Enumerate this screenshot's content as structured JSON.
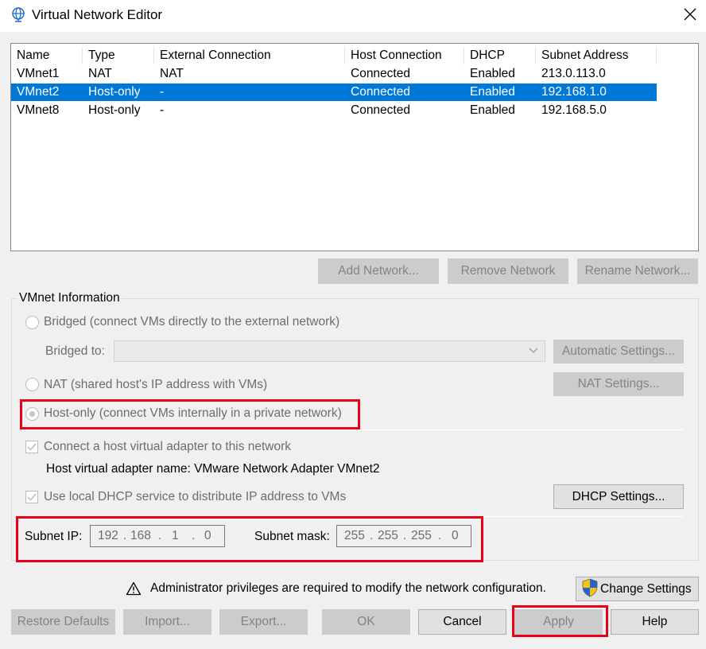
{
  "window": {
    "title": "Virtual Network Editor",
    "icon": "globe-icon",
    "close_icon": "close-icon"
  },
  "network_list": {
    "columns": [
      "Name",
      "Type",
      "External Connection",
      "Host Connection",
      "DHCP",
      "Subnet Address"
    ],
    "rows": [
      {
        "name": "VMnet1",
        "type": "NAT",
        "external": "NAT",
        "host": "Connected",
        "dhcp": "Enabled",
        "subnet": "213.0.113.0",
        "selected": false
      },
      {
        "name": "VMnet2",
        "type": "Host-only",
        "external": "-",
        "host": "Connected",
        "dhcp": "Enabled",
        "subnet": "192.168.1.0",
        "selected": true
      },
      {
        "name": "VMnet8",
        "type": "Host-only",
        "external": "-",
        "host": "Connected",
        "dhcp": "Enabled",
        "subnet": "192.168.5.0",
        "selected": false
      }
    ]
  },
  "list_buttons": {
    "add": "Add Network...",
    "remove": "Remove Network",
    "rename": "Rename Network..."
  },
  "vmnet_info": {
    "group_label": "VMnet Information",
    "bridged_label": "Bridged (connect VMs directly to the external network)",
    "bridged_to_label": "Bridged to:",
    "bridged_to_value": "",
    "automatic_settings": "Automatic Settings...",
    "nat_label": "NAT (shared host's IP address with VMs)",
    "nat_settings": "NAT Settings...",
    "hostonly_label": "Host-only (connect VMs internally in a private network)",
    "selected_mode": "Host-only",
    "connect_adapter_label": "Connect a host virtual adapter to this network",
    "connect_adapter_checked": true,
    "adapter_name_label": "Host virtual adapter name: VMware Network Adapter VMnet2",
    "dhcp_label": "Use local DHCP service to distribute IP address to VMs",
    "dhcp_checked": true,
    "dhcp_settings": "DHCP Settings...",
    "subnet_ip_label": "Subnet IP:",
    "subnet_ip": [
      "192",
      "168",
      "1",
      "0"
    ],
    "subnet_mask_label": "Subnet mask:",
    "subnet_mask": [
      "255",
      "255",
      "255",
      "0"
    ]
  },
  "admin_notice": {
    "text": "Administrator privileges are required to modify the network configuration.",
    "icon": "warning-icon",
    "change_settings": "Change Settings",
    "change_settings_icon": "uac-shield-icon"
  },
  "footer_buttons": {
    "restore": "Restore Defaults",
    "import": "Import...",
    "export": "Export...",
    "ok": "OK",
    "cancel": "Cancel",
    "apply": "Apply",
    "help": "Help"
  },
  "colors": {
    "selection": "#0078d7",
    "highlight": "#e8001c",
    "disabled_text": "#838383"
  }
}
